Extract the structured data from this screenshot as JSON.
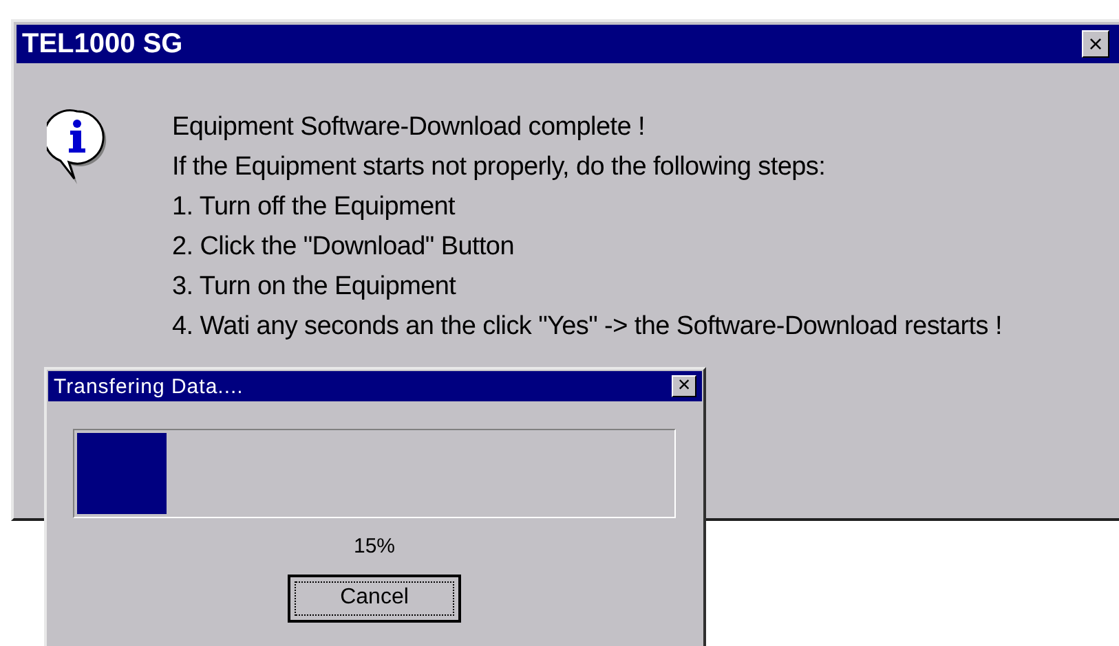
{
  "main_window": {
    "title": "TEL1000 SG",
    "close_glyph": "×",
    "message_lines": [
      "Equipment Software-Download complete !",
      "If the Equipment starts not properly, do the following steps:",
      "1. Turn off the Equipment",
      "2. Click the \"Download\" Button",
      "3. Turn on the Equipment",
      "4. Wati any seconds an the click \"Yes\" -> the Software-Download restarts !"
    ]
  },
  "progress_window": {
    "title": "Transfering Data....",
    "close_glyph": "×",
    "level": 0.15,
    "percent": "15%",
    "button": "Cancel"
  }
}
